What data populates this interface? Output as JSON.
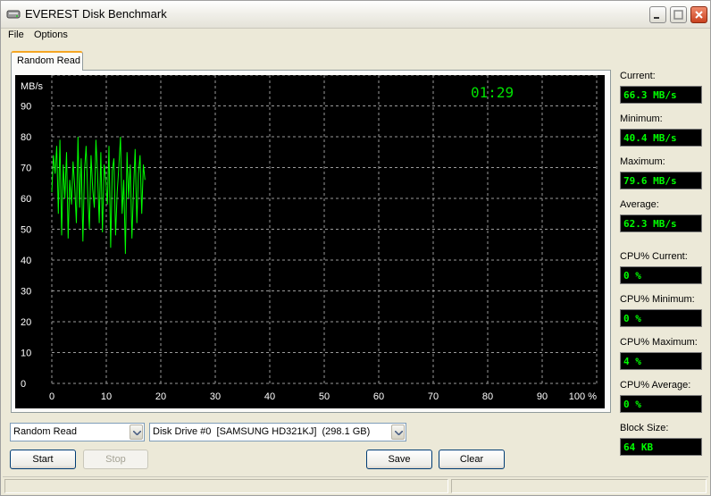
{
  "window": {
    "title": "EVEREST Disk Benchmark"
  },
  "menu": {
    "file": "File",
    "options": "Options"
  },
  "tab": {
    "label": "Random Read"
  },
  "chart": {
    "timer": "01:29",
    "y_unit": "MB/s",
    "y_ticks": [
      "90",
      "80",
      "70",
      "60",
      "50",
      "40",
      "30",
      "20",
      "10",
      "0"
    ],
    "x_ticks": [
      "0",
      "10",
      "20",
      "30",
      "40",
      "50",
      "60",
      "70",
      "80",
      "90",
      "100 %"
    ]
  },
  "chart_data": {
    "type": "line",
    "title": "",
    "xlabel": "%",
    "ylabel": "MB/s",
    "xlim": [
      0,
      100
    ],
    "ylim": [
      0,
      100
    ],
    "grid": true,
    "series": [
      {
        "color": "#00ff00",
        "x": [
          0,
          0.3,
          0.6,
          0.9,
          1.2,
          1.5,
          1.8,
          2.1,
          2.4,
          2.7,
          3,
          3.3,
          3.6,
          3.9,
          4.2,
          4.5,
          4.8,
          5.1,
          5.4,
          5.7,
          6,
          6.3,
          6.6,
          6.9,
          7.2,
          7.5,
          7.8,
          8.1,
          8.4,
          8.7,
          9,
          9.3,
          9.6,
          9.9,
          10.2,
          10.5,
          10.8,
          11.1,
          11.4,
          11.7,
          12,
          12.3,
          12.6,
          12.9,
          13.2,
          13.5,
          13.8,
          14.1,
          14.4,
          14.7,
          15,
          15.3,
          15.6,
          15.9,
          16.2,
          16.5,
          16.8,
          17.1
        ],
        "y": [
          62,
          74,
          68,
          77,
          55,
          79,
          48,
          71,
          60,
          75,
          47,
          66,
          58,
          72,
          64,
          52,
          80,
          57,
          73,
          46,
          69,
          77,
          61,
          50,
          74,
          63,
          57,
          79,
          68,
          52,
          75,
          49,
          71,
          66,
          58,
          77,
          44,
          69,
          73,
          48,
          62,
          70,
          80,
          55,
          66,
          42,
          75,
          60,
          71,
          47,
          63,
          76,
          52,
          68,
          74,
          55,
          71,
          66
        ]
      }
    ]
  },
  "stats": {
    "current_label": "Current:",
    "current": "66.3 MB/s",
    "minimum_label": "Minimum:",
    "minimum": "40.4 MB/s",
    "maximum_label": "Maximum:",
    "maximum": "79.6 MB/s",
    "average_label": "Average:",
    "average": "62.3 MB/s",
    "cpu_current_label": "CPU% Current:",
    "cpu_current": "0 %",
    "cpu_minimum_label": "CPU% Minimum:",
    "cpu_minimum": "0 %",
    "cpu_maximum_label": "CPU% Maximum:",
    "cpu_maximum": "4 %",
    "cpu_average_label": "CPU% Average:",
    "cpu_average": "0 %",
    "block_size_label": "Block Size:",
    "block_size": "64 KB"
  },
  "controls": {
    "mode": "Random Read",
    "drive": "Disk Drive #0  [SAMSUNG HD321KJ]  (298.1 GB)",
    "start": "Start",
    "stop": "Stop",
    "save": "Save",
    "clear": "Clear"
  }
}
